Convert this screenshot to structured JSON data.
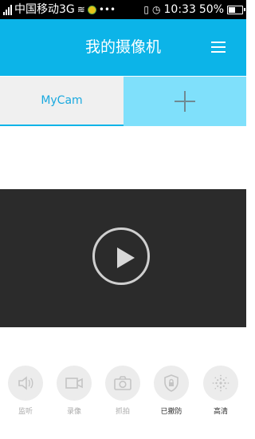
{
  "status_bar": {
    "carrier": "中国移动3G",
    "time": "10:33",
    "battery": "50%",
    "battery_level": 0.5
  },
  "header": {
    "title": "我的摄像机",
    "menu_icon": "menu-icon"
  },
  "tabs": {
    "camera_tab_label": "MyCam",
    "add_icon": "plus-icon"
  },
  "player": {
    "play_icon": "play-icon"
  },
  "controls": [
    {
      "label": "监听",
      "icon": "speaker-icon",
      "active": false
    },
    {
      "label": "录像",
      "icon": "video-camera-icon",
      "active": false
    },
    {
      "label": "抓拍",
      "icon": "camera-icon",
      "active": false
    },
    {
      "label": "已撤防",
      "icon": "shield-lock-icon",
      "active": true
    },
    {
      "label": "高清",
      "icon": "hd-dots-icon",
      "active": true
    }
  ],
  "colors": {
    "primary": "#0cb4e8",
    "tab_add_bg": "#7fe0fb",
    "video_bg": "#2b2b2b"
  }
}
